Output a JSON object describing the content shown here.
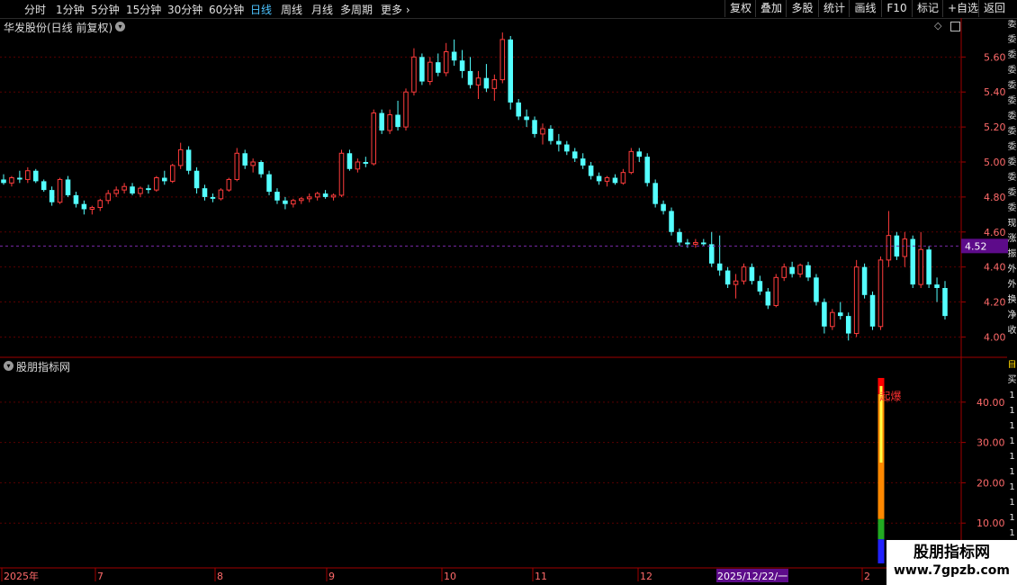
{
  "toolbar": {
    "periods": [
      "分时",
      "1分钟",
      "5分钟",
      "15分钟",
      "30分钟",
      "60分钟",
      "日线",
      "周线",
      "月线",
      "多周期",
      "更多"
    ],
    "active_period": "日线",
    "right_buttons": [
      "复权",
      "叠加",
      "多股",
      "统计",
      "画线",
      "F10",
      "标记",
      "+自选",
      "返回"
    ]
  },
  "main_panel": {
    "title": "华发股份(日线 前复权)",
    "current_price_label": "4.52"
  },
  "sub_panel": {
    "title": "股朋指标网",
    "signal_label": "起爆"
  },
  "date_axis": {
    "labels": [
      "2025年",
      "7",
      "8",
      "9",
      "10",
      "11",
      "12",
      "2025/12/22/一",
      "2"
    ]
  },
  "right_strip": {
    "main_chars": "委委委委委委委委委委委委委现涨振外外换净收",
    "sub_chars": "自买1111111111"
  },
  "watermark": {
    "line1": "股朋指标网",
    "line2": "www.7gpzb.com"
  },
  "colors": {
    "up": "#ff3c3c",
    "down": "#54ffff",
    "axis": "#a00000",
    "grid": "#5a0000",
    "tick_text": "#ff6a6a",
    "highlight_bg": "#5d0b8a"
  },
  "chart_data": [
    {
      "type": "candlestick",
      "title": "华发股份(日线 前复权)",
      "ylim": [
        3.92,
        5.72
      ],
      "yticks": [
        4.0,
        4.2,
        4.4,
        4.6,
        4.8,
        5.0,
        5.2,
        5.4,
        5.6
      ],
      "ytick_labels": [
        "4.00",
        "4.20",
        "4.40",
        "4.60",
        "4.80",
        "5.00",
        "5.20",
        "5.40",
        "5.60"
      ],
      "last_price": 4.52,
      "ohlc": [
        [
          4.9,
          4.93,
          4.87,
          4.88
        ],
        [
          4.88,
          4.92,
          4.86,
          4.91
        ],
        [
          4.91,
          4.95,
          4.88,
          4.9
        ],
        [
          4.9,
          4.97,
          4.88,
          4.95
        ],
        [
          4.95,
          4.96,
          4.88,
          4.89
        ],
        [
          4.89,
          4.9,
          4.83,
          4.84
        ],
        [
          4.84,
          4.86,
          4.75,
          4.77
        ],
        [
          4.77,
          4.91,
          4.76,
          4.9
        ],
        [
          4.9,
          4.92,
          4.8,
          4.81
        ],
        [
          4.81,
          4.83,
          4.74,
          4.76
        ],
        [
          4.76,
          4.78,
          4.7,
          4.73
        ],
        [
          4.73,
          4.75,
          4.7,
          4.74
        ],
        [
          4.74,
          4.79,
          4.72,
          4.78
        ],
        [
          4.78,
          4.84,
          4.76,
          4.82
        ],
        [
          4.82,
          4.86,
          4.8,
          4.84
        ],
        [
          4.84,
          4.88,
          4.82,
          4.86
        ],
        [
          4.86,
          4.88,
          4.81,
          4.82
        ],
        [
          4.82,
          4.86,
          4.8,
          4.85
        ],
        [
          4.85,
          4.87,
          4.82,
          4.84
        ],
        [
          4.84,
          4.92,
          4.83,
          4.91
        ],
        [
          4.91,
          4.95,
          4.87,
          4.89
        ],
        [
          4.89,
          4.99,
          4.88,
          4.98
        ],
        [
          4.98,
          5.11,
          4.96,
          5.07
        ],
        [
          5.07,
          5.09,
          4.93,
          4.95
        ],
        [
          4.95,
          4.97,
          4.82,
          4.85
        ],
        [
          4.85,
          4.87,
          4.78,
          4.8
        ],
        [
          4.8,
          4.82,
          4.77,
          4.79
        ],
        [
          4.79,
          4.85,
          4.78,
          4.84
        ],
        [
          4.84,
          4.91,
          4.83,
          4.9
        ],
        [
          4.9,
          5.08,
          4.89,
          5.05
        ],
        [
          5.05,
          5.07,
          4.96,
          4.98
        ],
        [
          4.98,
          5.02,
          4.94,
          5.0
        ],
        [
          5.0,
          5.01,
          4.91,
          4.93
        ],
        [
          4.93,
          4.95,
          4.81,
          4.83
        ],
        [
          4.83,
          4.85,
          4.76,
          4.78
        ],
        [
          4.78,
          4.8,
          4.73,
          4.76
        ],
        [
          4.76,
          4.79,
          4.74,
          4.78
        ],
        [
          4.78,
          4.8,
          4.76,
          4.79
        ],
        [
          4.79,
          4.82,
          4.77,
          4.8
        ],
        [
          4.8,
          4.83,
          4.78,
          4.82
        ],
        [
          4.82,
          4.84,
          4.79,
          4.8
        ],
        [
          4.8,
          4.82,
          4.78,
          4.81
        ],
        [
          4.81,
          5.07,
          4.8,
          5.05
        ],
        [
          5.05,
          5.07,
          4.95,
          4.96
        ],
        [
          4.96,
          5.02,
          4.94,
          5.0
        ],
        [
          5.0,
          5.03,
          4.97,
          4.99
        ],
        [
          4.99,
          5.3,
          4.98,
          5.28
        ],
        [
          5.28,
          5.3,
          5.16,
          5.18
        ],
        [
          5.18,
          5.3,
          5.16,
          5.27
        ],
        [
          5.27,
          5.35,
          5.18,
          5.2
        ],
        [
          5.2,
          5.42,
          5.18,
          5.4
        ],
        [
          5.4,
          5.65,
          5.38,
          5.6
        ],
        [
          5.6,
          5.62,
          5.44,
          5.46
        ],
        [
          5.46,
          5.6,
          5.44,
          5.57
        ],
        [
          5.57,
          5.62,
          5.49,
          5.51
        ],
        [
          5.51,
          5.68,
          5.49,
          5.63
        ],
        [
          5.63,
          5.7,
          5.55,
          5.58
        ],
        [
          5.58,
          5.64,
          5.48,
          5.52
        ],
        [
          5.52,
          5.6,
          5.42,
          5.44
        ],
        [
          5.44,
          5.52,
          5.36,
          5.48
        ],
        [
          5.48,
          5.56,
          5.4,
          5.42
        ],
        [
          5.42,
          5.5,
          5.35,
          5.47
        ],
        [
          5.47,
          5.74,
          5.45,
          5.7
        ],
        [
          5.7,
          5.72,
          5.3,
          5.34
        ],
        [
          5.34,
          5.36,
          5.24,
          5.26
        ],
        [
          5.26,
          5.3,
          5.2,
          5.24
        ],
        [
          5.24,
          5.26,
          5.14,
          5.16
        ],
        [
          5.16,
          5.22,
          5.1,
          5.19
        ],
        [
          5.19,
          5.21,
          5.1,
          5.12
        ],
        [
          5.12,
          5.16,
          5.06,
          5.1
        ],
        [
          5.1,
          5.12,
          5.04,
          5.06
        ],
        [
          5.06,
          5.08,
          5.0,
          5.02
        ],
        [
          5.02,
          5.05,
          4.96,
          4.98
        ],
        [
          4.98,
          5.0,
          4.9,
          4.92
        ],
        [
          4.92,
          4.94,
          4.87,
          4.89
        ],
        [
          4.89,
          4.92,
          4.86,
          4.91
        ],
        [
          4.91,
          4.93,
          4.87,
          4.88
        ],
        [
          4.88,
          4.96,
          4.87,
          4.94
        ],
        [
          4.94,
          5.08,
          4.93,
          5.06
        ],
        [
          5.06,
          5.08,
          5.0,
          5.03
        ],
        [
          5.03,
          5.05,
          4.86,
          4.88
        ],
        [
          4.88,
          4.9,
          4.74,
          4.76
        ],
        [
          4.76,
          4.78,
          4.7,
          4.72
        ],
        [
          4.72,
          4.74,
          4.58,
          4.6
        ],
        [
          4.6,
          4.62,
          4.52,
          4.54
        ],
        [
          4.54,
          4.56,
          4.51,
          4.53
        ],
        [
          4.53,
          4.56,
          4.51,
          4.54
        ],
        [
          4.54,
          4.56,
          4.52,
          4.53
        ],
        [
          4.53,
          4.6,
          4.4,
          4.42
        ],
        [
          4.42,
          4.58,
          4.35,
          4.38
        ],
        [
          4.38,
          4.4,
          4.28,
          4.3
        ],
        [
          4.3,
          4.36,
          4.22,
          4.32
        ],
        [
          4.32,
          4.42,
          4.3,
          4.4
        ],
        [
          4.4,
          4.42,
          4.3,
          4.32
        ],
        [
          4.32,
          4.35,
          4.24,
          4.26
        ],
        [
          4.26,
          4.28,
          4.16,
          4.18
        ],
        [
          4.18,
          4.36,
          4.17,
          4.34
        ],
        [
          4.34,
          4.42,
          4.32,
          4.4
        ],
        [
          4.4,
          4.43,
          4.34,
          4.36
        ],
        [
          4.36,
          4.42,
          4.34,
          4.41
        ],
        [
          4.41,
          4.43,
          4.32,
          4.34
        ],
        [
          4.34,
          4.36,
          4.18,
          4.2
        ],
        [
          4.2,
          4.22,
          4.02,
          4.06
        ],
        [
          4.06,
          4.16,
          4.04,
          4.14
        ],
        [
          4.14,
          4.2,
          4.1,
          4.12
        ],
        [
          4.12,
          4.14,
          3.98,
          4.02
        ],
        [
          4.02,
          4.44,
          4.0,
          4.4
        ],
        [
          4.4,
          4.42,
          4.22,
          4.24
        ],
        [
          4.24,
          4.26,
          4.04,
          4.06
        ],
        [
          4.06,
          4.46,
          4.04,
          4.44
        ],
        [
          4.44,
          4.72,
          4.4,
          4.58
        ],
        [
          4.58,
          4.6,
          4.44,
          4.46
        ],
        [
          4.46,
          4.6,
          4.4,
          4.56
        ],
        [
          4.56,
          4.58,
          4.28,
          4.3
        ],
        [
          4.3,
          4.6,
          4.28,
          4.5
        ],
        [
          4.5,
          4.52,
          4.28,
          4.3
        ],
        [
          4.3,
          4.34,
          4.2,
          4.28
        ],
        [
          4.28,
          4.32,
          4.1,
          4.12
        ]
      ]
    },
    {
      "type": "bar",
      "title": "股朋指标网",
      "ylim": [
        0,
        48
      ],
      "yticks": [
        10,
        20,
        30,
        40
      ],
      "ytick_labels": [
        "10.00",
        "20.00",
        "30.00",
        "40.00"
      ],
      "bar_segments": [
        {
          "from": 0,
          "to": 6,
          "color": "#2222ff"
        },
        {
          "from": 6,
          "to": 11,
          "color": "#22aa22"
        },
        {
          "from": 11,
          "to": 42,
          "color": "#ff8800"
        },
        {
          "from": 42,
          "to": 46,
          "color": "#ff0000"
        }
      ],
      "bar_index_from_end": 8
    }
  ]
}
